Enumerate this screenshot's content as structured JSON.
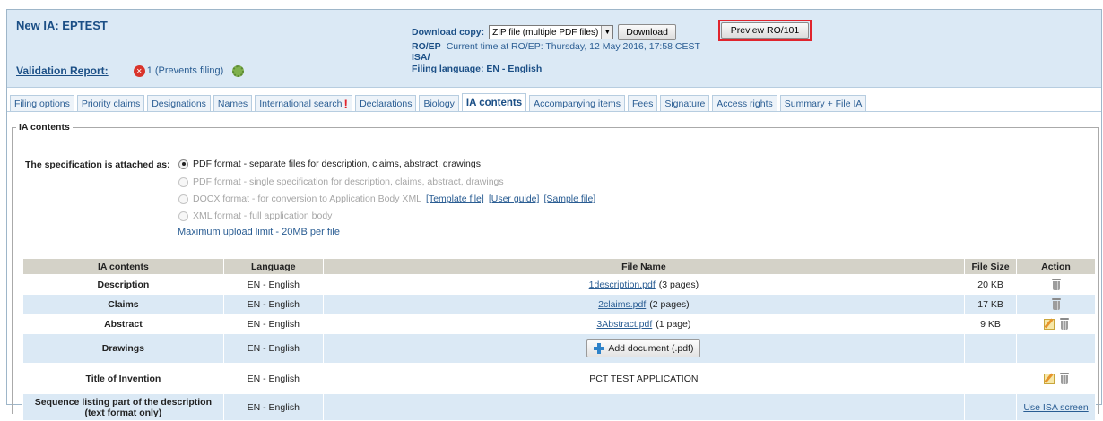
{
  "header": {
    "title": "New IA: EPTEST",
    "validation_label": "Validation Report:",
    "error_text": "1 (Prevents filing)",
    "download_label": "Download copy:",
    "download_select_value": "ZIP file (multiple PDF files)",
    "download_button": "Download",
    "roep_label": "RO/EP",
    "current_time": "Current time at RO/EP:  Thursday, 12 May 2016, 17:58 CEST",
    "isa_label": "ISA/",
    "filing_language": "Filing language: EN - English",
    "preview_button": "Preview RO/101"
  },
  "tabs": [
    {
      "label": "Filing options"
    },
    {
      "label": "Priority claims"
    },
    {
      "label": "Designations"
    },
    {
      "label": "Names"
    },
    {
      "label": "International search"
    },
    {
      "label": "Declarations"
    },
    {
      "label": "Biology"
    },
    {
      "label": "IA contents",
      "active": true
    },
    {
      "label": "Accompanying items"
    },
    {
      "label": "Fees"
    },
    {
      "label": "Signature"
    },
    {
      "label": "Access rights"
    },
    {
      "label": "Summary + File IA"
    }
  ],
  "tab_alert": "!",
  "section": {
    "legend": "IA contents",
    "spec_label": "The specification is attached as:",
    "options": [
      {
        "label": "PDF format - separate files for description, claims, abstract, drawings",
        "selected": true,
        "enabled": true
      },
      {
        "label": "PDF format - single specification for description, claims, abstract, drawings",
        "selected": false,
        "enabled": false
      },
      {
        "label": "DOCX format - for conversion to Application Body XML",
        "selected": false,
        "enabled": false,
        "links": [
          "[Template file]",
          "[User guide]",
          "[Sample file]"
        ]
      },
      {
        "label": "XML format - full application body",
        "selected": false,
        "enabled": false
      }
    ],
    "max_upload": "Maximum upload limit - 20MB per file"
  },
  "table": {
    "columns": [
      "IA contents",
      "Language",
      "File Name",
      "File Size",
      "Action"
    ],
    "rows": [
      {
        "name": "Description",
        "language": "EN - English",
        "file": "1description.pdf",
        "pages": "(3 pages)",
        "size": "20 KB"
      },
      {
        "name": "Claims",
        "language": "EN - English",
        "file": "2claims.pdf",
        "pages": "(2 pages)",
        "size": "17 KB"
      },
      {
        "name": "Abstract",
        "language": "EN - English",
        "file": "3Abstract.pdf",
        "pages": "(1 page)",
        "size": "9 KB"
      },
      {
        "name": "Drawings",
        "language": "EN - English",
        "add_button": "Add document (.pdf)"
      },
      {
        "name": "Title of Invention",
        "language": "EN - English",
        "text": "PCT TEST APPLICATION"
      },
      {
        "name_line1": "Sequence listing part of the description",
        "name_line2": "(text format only)",
        "language": "EN - English",
        "action_link": "Use ISA screen"
      }
    ]
  },
  "colors": {
    "header_bg": "#dbe9f5",
    "link": "#2a5d93",
    "error": "#d9342b",
    "highlight_box": "#e0242d"
  }
}
